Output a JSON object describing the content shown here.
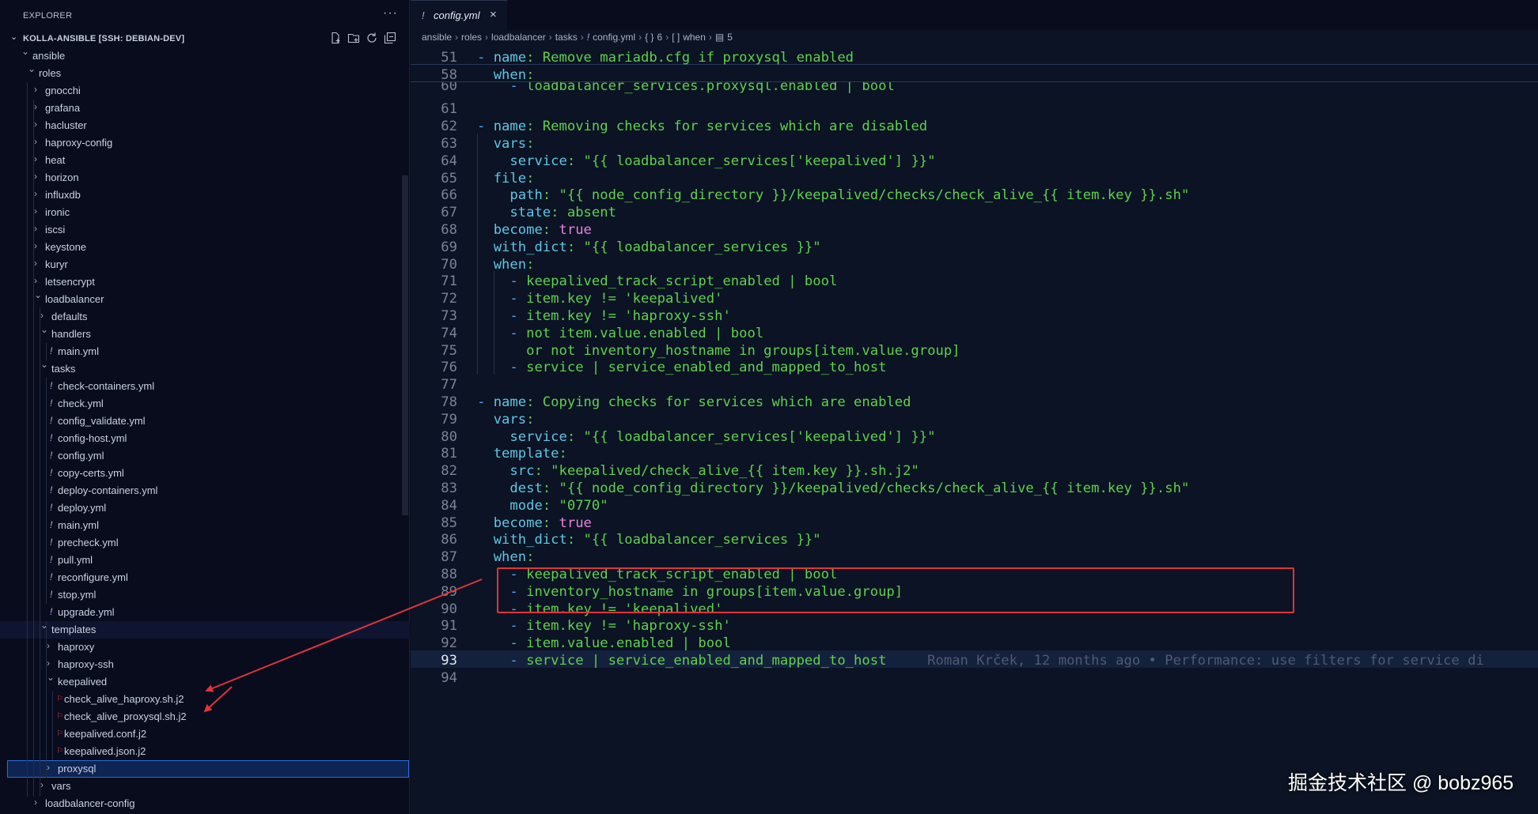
{
  "sidebar": {
    "title": "EXPLORER",
    "workspace": "KOLLA-ANSIBLE [SSH: DEBIAN-DEV]",
    "tree": [
      {
        "label": "ansible",
        "depth": 0,
        "type": "folder-open"
      },
      {
        "label": "roles",
        "depth": 1,
        "type": "folder-open"
      },
      {
        "label": "gnocchi",
        "depth": 2,
        "type": "folder"
      },
      {
        "label": "grafana",
        "depth": 2,
        "type": "folder"
      },
      {
        "label": "hacluster",
        "depth": 2,
        "type": "folder"
      },
      {
        "label": "haproxy-config",
        "depth": 2,
        "type": "folder"
      },
      {
        "label": "heat",
        "depth": 2,
        "type": "folder"
      },
      {
        "label": "horizon",
        "depth": 2,
        "type": "folder"
      },
      {
        "label": "influxdb",
        "depth": 2,
        "type": "folder"
      },
      {
        "label": "ironic",
        "depth": 2,
        "type": "folder"
      },
      {
        "label": "iscsi",
        "depth": 2,
        "type": "folder"
      },
      {
        "label": "keystone",
        "depth": 2,
        "type": "folder"
      },
      {
        "label": "kuryr",
        "depth": 2,
        "type": "folder"
      },
      {
        "label": "letsencrypt",
        "depth": 2,
        "type": "folder"
      },
      {
        "label": "loadbalancer",
        "depth": 2,
        "type": "folder-open"
      },
      {
        "label": "defaults",
        "depth": 3,
        "type": "folder"
      },
      {
        "label": "handlers",
        "depth": 3,
        "type": "folder-open"
      },
      {
        "label": "main.yml",
        "depth": 4,
        "type": "yaml"
      },
      {
        "label": "tasks",
        "depth": 3,
        "type": "folder-open"
      },
      {
        "label": "check-containers.yml",
        "depth": 4,
        "type": "yaml"
      },
      {
        "label": "check.yml",
        "depth": 4,
        "type": "yaml"
      },
      {
        "label": "config_validate.yml",
        "depth": 4,
        "type": "yaml"
      },
      {
        "label": "config-host.yml",
        "depth": 4,
        "type": "yaml"
      },
      {
        "label": "config.yml",
        "depth": 4,
        "type": "yaml"
      },
      {
        "label": "copy-certs.yml",
        "depth": 4,
        "type": "yaml"
      },
      {
        "label": "deploy-containers.yml",
        "depth": 4,
        "type": "yaml"
      },
      {
        "label": "deploy.yml",
        "depth": 4,
        "type": "yaml"
      },
      {
        "label": "main.yml",
        "depth": 4,
        "type": "yaml"
      },
      {
        "label": "precheck.yml",
        "depth": 4,
        "type": "yaml"
      },
      {
        "label": "pull.yml",
        "depth": 4,
        "type": "yaml"
      },
      {
        "label": "reconfigure.yml",
        "depth": 4,
        "type": "yaml"
      },
      {
        "label": "stop.yml",
        "depth": 4,
        "type": "yaml"
      },
      {
        "label": "upgrade.yml",
        "depth": 4,
        "type": "yaml"
      },
      {
        "label": "templates",
        "depth": 3,
        "type": "folder-open",
        "hover": true
      },
      {
        "label": "haproxy",
        "depth": 4,
        "type": "folder"
      },
      {
        "label": "haproxy-ssh",
        "depth": 4,
        "type": "folder"
      },
      {
        "label": "keepalived",
        "depth": 4,
        "type": "folder-open"
      },
      {
        "label": "check_alive_haproxy.sh.j2",
        "depth": 5,
        "type": "j2"
      },
      {
        "label": "check_alive_proxysql.sh.j2",
        "depth": 5,
        "type": "j2"
      },
      {
        "label": "keepalived.conf.j2",
        "depth": 5,
        "type": "j2"
      },
      {
        "label": "keepalived.json.j2",
        "depth": 5,
        "type": "j2"
      },
      {
        "label": "proxysql",
        "depth": 4,
        "type": "folder",
        "selected": true
      },
      {
        "label": "vars",
        "depth": 3,
        "type": "folder"
      },
      {
        "label": "loadbalancer-config",
        "depth": 2,
        "type": "folder"
      }
    ]
  },
  "tab": {
    "icon": "!",
    "label": "config.yml",
    "close": "×"
  },
  "breadcrumb": [
    {
      "text": "ansible"
    },
    {
      "text": "roles"
    },
    {
      "text": "loadbalancer"
    },
    {
      "text": "tasks"
    },
    {
      "text": "config.yml",
      "icon": "!"
    },
    {
      "text": "6",
      "icon": "{ }"
    },
    {
      "text": "when",
      "icon": "[ ]"
    },
    {
      "text": "5",
      "icon": "▤"
    }
  ],
  "code": [
    {
      "n": "51",
      "sticky": true,
      "tokens": [
        [
          "dash",
          "- "
        ],
        [
          "key",
          "name"
        ],
        [
          "plain",
          ": Remove mariadb.cfg if proxysql enabled"
        ]
      ]
    },
    {
      "n": "58",
      "sticky": true,
      "tokens": [
        [
          "plain",
          "  "
        ],
        [
          "key",
          "when"
        ],
        [
          "plain",
          ":"
        ]
      ]
    },
    {
      "n": "60",
      "partial": true,
      "tokens": [
        [
          "plain",
          "    "
        ],
        [
          "dash",
          "- "
        ],
        [
          "plain",
          "loadbalancer_services.proxysql.enabled | bool"
        ]
      ]
    },
    {
      "n": "61",
      "tokens": []
    },
    {
      "n": "62",
      "tokens": [
        [
          "dash",
          "- "
        ],
        [
          "key",
          "name"
        ],
        [
          "plain",
          ": Removing checks for services which are disabled"
        ]
      ]
    },
    {
      "n": "63",
      "tokens": [
        [
          "plain",
          "  "
        ],
        [
          "key",
          "vars"
        ],
        [
          "plain",
          ":"
        ]
      ]
    },
    {
      "n": "64",
      "tokens": [
        [
          "plain",
          "    "
        ],
        [
          "key",
          "service"
        ],
        [
          "plain",
          ": "
        ],
        [
          "str",
          "\"{{ loadbalancer_services['keepalived'] }}\""
        ]
      ]
    },
    {
      "n": "65",
      "tokens": [
        [
          "plain",
          "  "
        ],
        [
          "key",
          "file"
        ],
        [
          "plain",
          ":"
        ]
      ]
    },
    {
      "n": "66",
      "tokens": [
        [
          "plain",
          "    "
        ],
        [
          "key",
          "path"
        ],
        [
          "plain",
          ": "
        ],
        [
          "str",
          "\"{{ node_config_directory }}/keepalived/checks/check_alive_{{ item.key }}.sh\""
        ]
      ]
    },
    {
      "n": "67",
      "tokens": [
        [
          "plain",
          "    "
        ],
        [
          "key",
          "state"
        ],
        [
          "plain",
          ": absent"
        ]
      ]
    },
    {
      "n": "68",
      "tokens": [
        [
          "plain",
          "  "
        ],
        [
          "key",
          "become"
        ],
        [
          "plain",
          ": "
        ],
        [
          "bool",
          "true"
        ]
      ]
    },
    {
      "n": "69",
      "tokens": [
        [
          "plain",
          "  "
        ],
        [
          "key",
          "with_dict"
        ],
        [
          "plain",
          ": "
        ],
        [
          "str",
          "\"{{ loadbalancer_services }}\""
        ]
      ]
    },
    {
      "n": "70",
      "tokens": [
        [
          "plain",
          "  "
        ],
        [
          "key",
          "when"
        ],
        [
          "plain",
          ":"
        ]
      ]
    },
    {
      "n": "71",
      "tokens": [
        [
          "plain",
          "    "
        ],
        [
          "dash",
          "- "
        ],
        [
          "plain",
          "keepalived_track_script_enabled | bool"
        ]
      ]
    },
    {
      "n": "72",
      "tokens": [
        [
          "plain",
          "    "
        ],
        [
          "dash",
          "- "
        ],
        [
          "plain",
          "item.key != 'keepalived'"
        ]
      ]
    },
    {
      "n": "73",
      "tokens": [
        [
          "plain",
          "    "
        ],
        [
          "dash",
          "- "
        ],
        [
          "plain",
          "item.key != 'haproxy-ssh'"
        ]
      ]
    },
    {
      "n": "74",
      "tokens": [
        [
          "plain",
          "    "
        ],
        [
          "dash",
          "- "
        ],
        [
          "plain",
          "not item.value.enabled | bool"
        ]
      ]
    },
    {
      "n": "75",
      "tokens": [
        [
          "plain",
          "      or not inventory_hostname in groups[item.value.group]"
        ]
      ]
    },
    {
      "n": "76",
      "tokens": [
        [
          "plain",
          "    "
        ],
        [
          "dash",
          "- "
        ],
        [
          "plain",
          "service | service_enabled_and_mapped_to_host"
        ]
      ]
    },
    {
      "n": "77",
      "tokens": []
    },
    {
      "n": "78",
      "tokens": [
        [
          "dash",
          "- "
        ],
        [
          "key",
          "name"
        ],
        [
          "plain",
          ": Copying checks for services which are enabled"
        ]
      ]
    },
    {
      "n": "79",
      "tokens": [
        [
          "plain",
          "  "
        ],
        [
          "key",
          "vars"
        ],
        [
          "plain",
          ":"
        ]
      ]
    },
    {
      "n": "80",
      "tokens": [
        [
          "plain",
          "    "
        ],
        [
          "key",
          "service"
        ],
        [
          "plain",
          ": "
        ],
        [
          "str",
          "\"{{ loadbalancer_services['keepalived'] }}\""
        ]
      ]
    },
    {
      "n": "81",
      "tokens": [
        [
          "plain",
          "  "
        ],
        [
          "key",
          "template"
        ],
        [
          "plain",
          ":"
        ]
      ]
    },
    {
      "n": "82",
      "tokens": [
        [
          "plain",
          "    "
        ],
        [
          "key",
          "src"
        ],
        [
          "plain",
          ": "
        ],
        [
          "str",
          "\"keepalived/check_alive_{{ item.key }}.sh.j2\""
        ]
      ]
    },
    {
      "n": "83",
      "tokens": [
        [
          "plain",
          "    "
        ],
        [
          "key",
          "dest"
        ],
        [
          "plain",
          ": "
        ],
        [
          "str",
          "\"{{ node_config_directory }}/keepalived/checks/check_alive_{{ item.key }}.sh\""
        ]
      ]
    },
    {
      "n": "84",
      "tokens": [
        [
          "plain",
          "    "
        ],
        [
          "key",
          "mode"
        ],
        [
          "plain",
          ": "
        ],
        [
          "str",
          "\"0770\""
        ]
      ]
    },
    {
      "n": "85",
      "tokens": [
        [
          "plain",
          "  "
        ],
        [
          "key",
          "become"
        ],
        [
          "plain",
          ": "
        ],
        [
          "bool",
          "true"
        ]
      ]
    },
    {
      "n": "86",
      "tokens": [
        [
          "plain",
          "  "
        ],
        [
          "key",
          "with_dict"
        ],
        [
          "plain",
          ": "
        ],
        [
          "str",
          "\"{{ loadbalancer_services }}\""
        ]
      ]
    },
    {
      "n": "87",
      "tokens": [
        [
          "plain",
          "  "
        ],
        [
          "key",
          "when"
        ],
        [
          "plain",
          ":"
        ]
      ]
    },
    {
      "n": "88",
      "tokens": [
        [
          "plain",
          "    "
        ],
        [
          "dash",
          "- "
        ],
        [
          "plain",
          "keepalived_track_script_enabled | bool"
        ]
      ]
    },
    {
      "n": "89",
      "tokens": [
        [
          "plain",
          "    "
        ],
        [
          "dash",
          "- "
        ],
        [
          "plain",
          "inventory_hostname in groups[item.value.group]"
        ]
      ]
    },
    {
      "n": "90",
      "tokens": [
        [
          "plain",
          "    "
        ],
        [
          "dash",
          "- "
        ],
        [
          "plain",
          "item.key != 'keepalived'"
        ]
      ]
    },
    {
      "n": "91",
      "tokens": [
        [
          "plain",
          "    "
        ],
        [
          "dash",
          "- "
        ],
        [
          "plain",
          "item.key != 'haproxy-ssh'"
        ]
      ]
    },
    {
      "n": "92",
      "tokens": [
        [
          "plain",
          "    "
        ],
        [
          "dash",
          "- "
        ],
        [
          "plain",
          "item.value.enabled | bool"
        ]
      ]
    },
    {
      "n": "93",
      "current": true,
      "tokens": [
        [
          "plain",
          "    "
        ],
        [
          "dash",
          "- "
        ],
        [
          "plain",
          "service | service_enabled_and_mapped_to_host"
        ],
        [
          "blame",
          "     Roman Krček, 12 months ago • Performance: use filters for service di"
        ]
      ]
    },
    {
      "n": "94",
      "partial": true,
      "tokens": []
    }
  ],
  "watermark": "掘金技术社区 @ bobz965",
  "colors": {
    "annotation": "#e0343a",
    "string": "#5ed24a",
    "key": "#5dc7e4",
    "bool": "#ef7fe0",
    "dash": "#4ea6ff"
  }
}
